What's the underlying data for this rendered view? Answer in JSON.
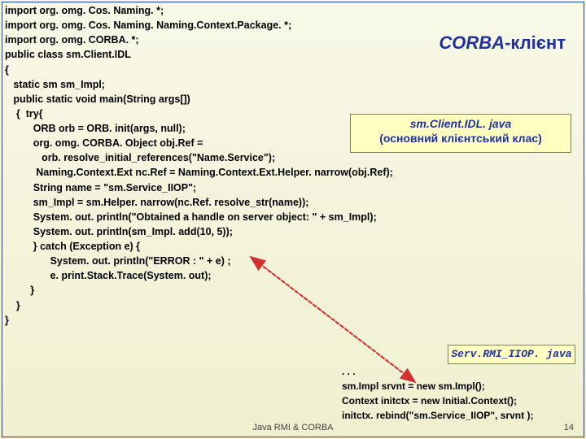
{
  "title": {
    "corba": "CORBA",
    "suffix": "-клієнт"
  },
  "box1": {
    "filename": "sm.Client.IDL. java",
    "desc": "(основний клієнтський клас)"
  },
  "box2": "Serv.RMI_IIOP. java",
  "code": {
    "l1": "import org. omg. Cos. Naming. *;",
    "l2": "import org. omg. Cos. Naming. Naming.Context.Package. *;",
    "l3": "import org. omg. CORBA. *;",
    "l4": "public class sm.Client.IDL",
    "l5": "{",
    "l6": "   static sm sm_Impl;",
    "l7": "   public static void main(String args[])",
    "l8": "    {  try{",
    "l9": "          ORB orb = ORB. init(args, null);",
    "l10": "          org. omg. CORBA. Object obj.Ref =",
    "l11": "             orb. resolve_initial_references(\"Name.Service\");",
    "l12": "           Naming.Context.Ext nc.Ref = Naming.Context.Ext.Helper. narrow(obj.Ref);",
    "l13": "          String name = \"sm.Service_IIOP\";",
    "l14": "          sm_Impl = sm.Helper. narrow(nc.Ref. resolve_str(name));",
    "l15": "          System. out. println(\"Obtained a handle on server object: \" + sm_Impl);",
    "l16": "          System. out. println(sm_Impl. add(10, 5));",
    "l17": "          } catch (Exception e) {",
    "l18": "                System. out. println(\"ERROR : \" + e) ;",
    "l19": "                e. print.Stack.Trace(System. out);",
    "l20": "         }",
    "l21": "    }",
    "l22": "}"
  },
  "corner": {
    "l1": ". . .",
    "l2": "sm.Impl srvnt = new sm.Impl();",
    "l3": "Context initctx = new Initial.Context();",
    "l4": "initctx. rebind(\"sm.Service_IIOP\", srvnt );"
  },
  "footer": "Java RMI & CORBA",
  "pagenum": "14"
}
